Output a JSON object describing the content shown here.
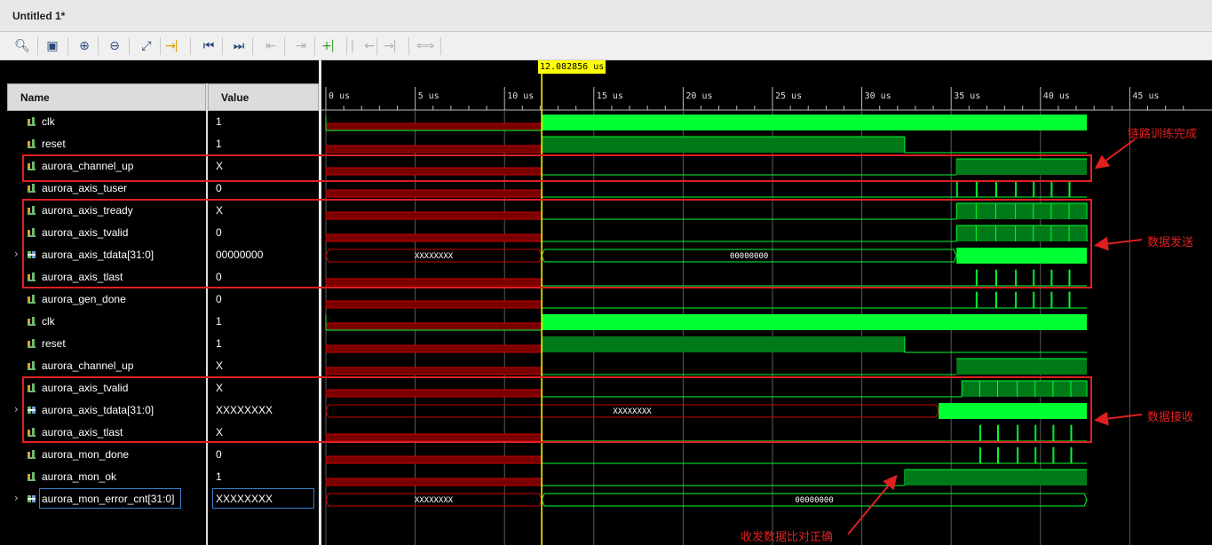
{
  "window": {
    "title": "Untitled 1*"
  },
  "toolbar": {
    "icons": [
      "search-icon",
      "save-icon",
      "zoom-in-icon",
      "zoom-out-icon",
      "zoom-fit-icon",
      "goto-cursor-icon",
      "goto-start-icon",
      "goto-end-icon",
      "prev-transition-icon",
      "next-transition-icon",
      "add-marker-icon",
      "prev-marker-icon",
      "next-marker-icon",
      "swap-cursors-icon"
    ]
  },
  "columns": {
    "name": "Name",
    "value": "Value"
  },
  "cursor": {
    "time_us": 12.082856,
    "label": "12.082856 us"
  },
  "timeline": {
    "unit": "us",
    "max_us": 48.5,
    "ticks": [
      {
        "t": 0,
        "label": "0 us"
      },
      {
        "t": 5,
        "label": "5 us"
      },
      {
        "t": 10,
        "label": "10 us"
      },
      {
        "t": 15,
        "label": "15 us"
      },
      {
        "t": 20,
        "label": "20 us"
      },
      {
        "t": 25,
        "label": "25 us"
      },
      {
        "t": 30,
        "label": "30 us"
      },
      {
        "t": 35,
        "label": "35 us"
      },
      {
        "t": 40,
        "label": "40 us"
      },
      {
        "t": 45,
        "label": "45 us"
      }
    ]
  },
  "signals": [
    {
      "name": "clk",
      "value": "1",
      "type": "bit"
    },
    {
      "name": "reset",
      "value": "1",
      "type": "bit"
    },
    {
      "name": "aurora_channel_up",
      "value": "X",
      "type": "bit"
    },
    {
      "name": "aurora_axis_tuser",
      "value": "0",
      "type": "bit"
    },
    {
      "name": "aurora_axis_tready",
      "value": "X",
      "type": "bit"
    },
    {
      "name": "aurora_axis_tvalid",
      "value": "0",
      "type": "bit"
    },
    {
      "name": "aurora_axis_tdata[31:0]",
      "value": "00000000",
      "type": "bus",
      "bus_labels": [
        "XXXXXXXX",
        "00000000"
      ]
    },
    {
      "name": "aurora_axis_tlast",
      "value": "0",
      "type": "bit"
    },
    {
      "name": "aurora_gen_done",
      "value": "0",
      "type": "bit"
    },
    {
      "name": "clk",
      "value": "1",
      "type": "bit"
    },
    {
      "name": "reset",
      "value": "1",
      "type": "bit"
    },
    {
      "name": "aurora_channel_up",
      "value": "X",
      "type": "bit"
    },
    {
      "name": "aurora_axis_tvalid",
      "value": "X",
      "type": "bit"
    },
    {
      "name": "aurora_axis_tdata[31:0]",
      "value": "XXXXXXXX",
      "type": "bus",
      "bus_labels": [
        "XXXXXXXX"
      ]
    },
    {
      "name": "aurora_axis_tlast",
      "value": "X",
      "type": "bit"
    },
    {
      "name": "aurora_mon_done",
      "value": "0",
      "type": "bit"
    },
    {
      "name": "aurora_mon_ok",
      "value": "1",
      "type": "bit"
    },
    {
      "name": "aurora_mon_error_cnt[31:0]",
      "value": "XXXXXXXX",
      "type": "bus",
      "bus_labels": [
        "XXXXXXXX",
        "00000000"
      ]
    }
  ],
  "annotations": [
    {
      "text": "链路训练完成"
    },
    {
      "text": "数据发送"
    },
    {
      "text": "数据接收"
    },
    {
      "text": "收发数据比对正确"
    }
  ],
  "colors": {
    "signal_green": "#00ff33",
    "signal_dark_green": "#00aa22",
    "undefined_red": "#cc0000",
    "cursor": "#ffff00",
    "annotation": "#e02020"
  }
}
